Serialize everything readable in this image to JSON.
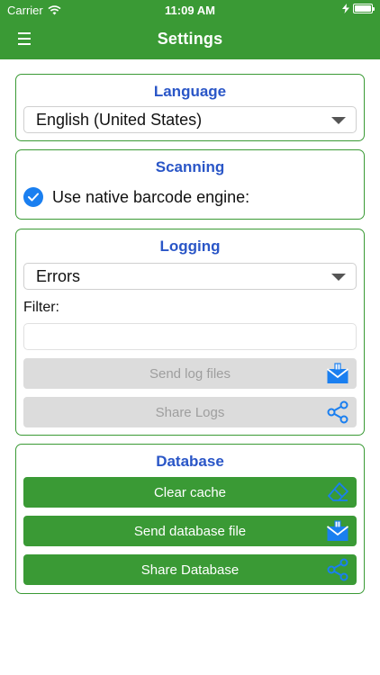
{
  "status_bar": {
    "carrier": "Carrier",
    "time": "11:09 AM"
  },
  "navbar": {
    "title": "Settings"
  },
  "language": {
    "title": "Language",
    "selected": "English (United States)"
  },
  "scanning": {
    "title": "Scanning",
    "native_engine_label": "Use native barcode engine:",
    "native_engine_checked": true
  },
  "logging": {
    "title": "Logging",
    "level_selected": "Errors",
    "filter_label": "Filter:",
    "filter_value": "",
    "send_logs_label": "Send log files",
    "share_logs_label": "Share Logs"
  },
  "database": {
    "title": "Database",
    "clear_cache_label": "Clear cache",
    "send_db_label": "Send database file",
    "share_db_label": "Share Database"
  },
  "colors": {
    "brand_green": "#3a9a35",
    "title_blue": "#2a56c7",
    "icon_blue": "#1a7ff0",
    "disabled_gray": "#dcdcdc"
  },
  "icons": {
    "menu": "hamburger-icon",
    "wifi": "wifi-icon",
    "battery": "battery-icon",
    "dropdown": "caret-down-icon",
    "checkbox": "checkmark-icon",
    "mail": "mail-icon",
    "share": "share-icon",
    "eraser": "eraser-icon"
  }
}
